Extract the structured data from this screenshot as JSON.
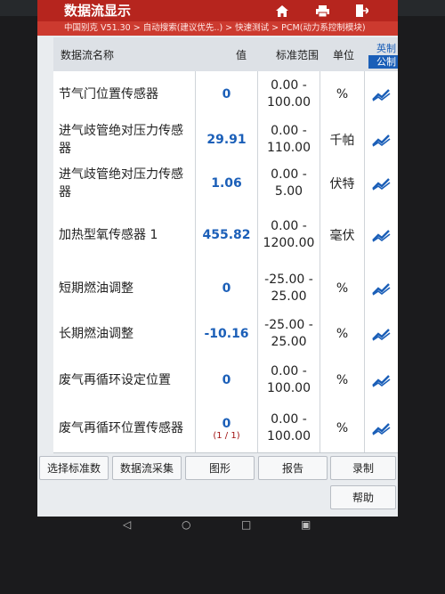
{
  "header": {
    "title": "数据流显示",
    "breadcrumb": "中国别克 V51.30 > 自动搜索(建议优先..) > 快速测试 > PCM(动力系控制模块)"
  },
  "toolbar": {
    "home_icon": "home-icon",
    "print_icon": "print-icon",
    "exit_icon": "exit-icon"
  },
  "columns": {
    "name": "数据流名称",
    "value": "值",
    "range": "标准范围",
    "unit": "单位",
    "unit_imperial": "英制",
    "unit_metric": "公制"
  },
  "rows": [
    {
      "name": "节气门位置传感器",
      "value": "0",
      "range": "0.00 - 100.00",
      "unit": "%"
    },
    {
      "name": "进气歧管绝对压力传感器",
      "value": "29.91",
      "range": "0.00 - 110.00",
      "unit": "千帕"
    },
    {
      "name": "进气歧管绝对压力传感器",
      "value": "1.06",
      "range": "0.00 - 5.00",
      "unit": "伏特"
    },
    {
      "name": "加热型氧传感器 1",
      "value": "455.82",
      "range": "0.00 - 1200.00",
      "unit": "毫伏"
    },
    {
      "name": "短期燃油调整",
      "value": "0",
      "range": "-25.00 - 25.00",
      "unit": "%"
    },
    {
      "name": "长期燃油调整",
      "value": "-10.16",
      "range": "-25.00 - 25.00",
      "unit": "%"
    },
    {
      "name": "废气再循环设定位置",
      "value": "0",
      "range": "0.00 - 100.00",
      "unit": "%"
    },
    {
      "name": "废气再循环位置传感器",
      "value": "0",
      "range": "0.00 - 100.00",
      "unit": "%",
      "page": "(1 / 1)"
    }
  ],
  "buttons": {
    "select_standard": "选择标准数",
    "data_capture": "数据流采集",
    "graph": "图形",
    "report": "报告",
    "record": "录制",
    "help": "帮助"
  },
  "colors": {
    "titlebar": "#b6251e",
    "value_blue": "#1b5fb8"
  }
}
